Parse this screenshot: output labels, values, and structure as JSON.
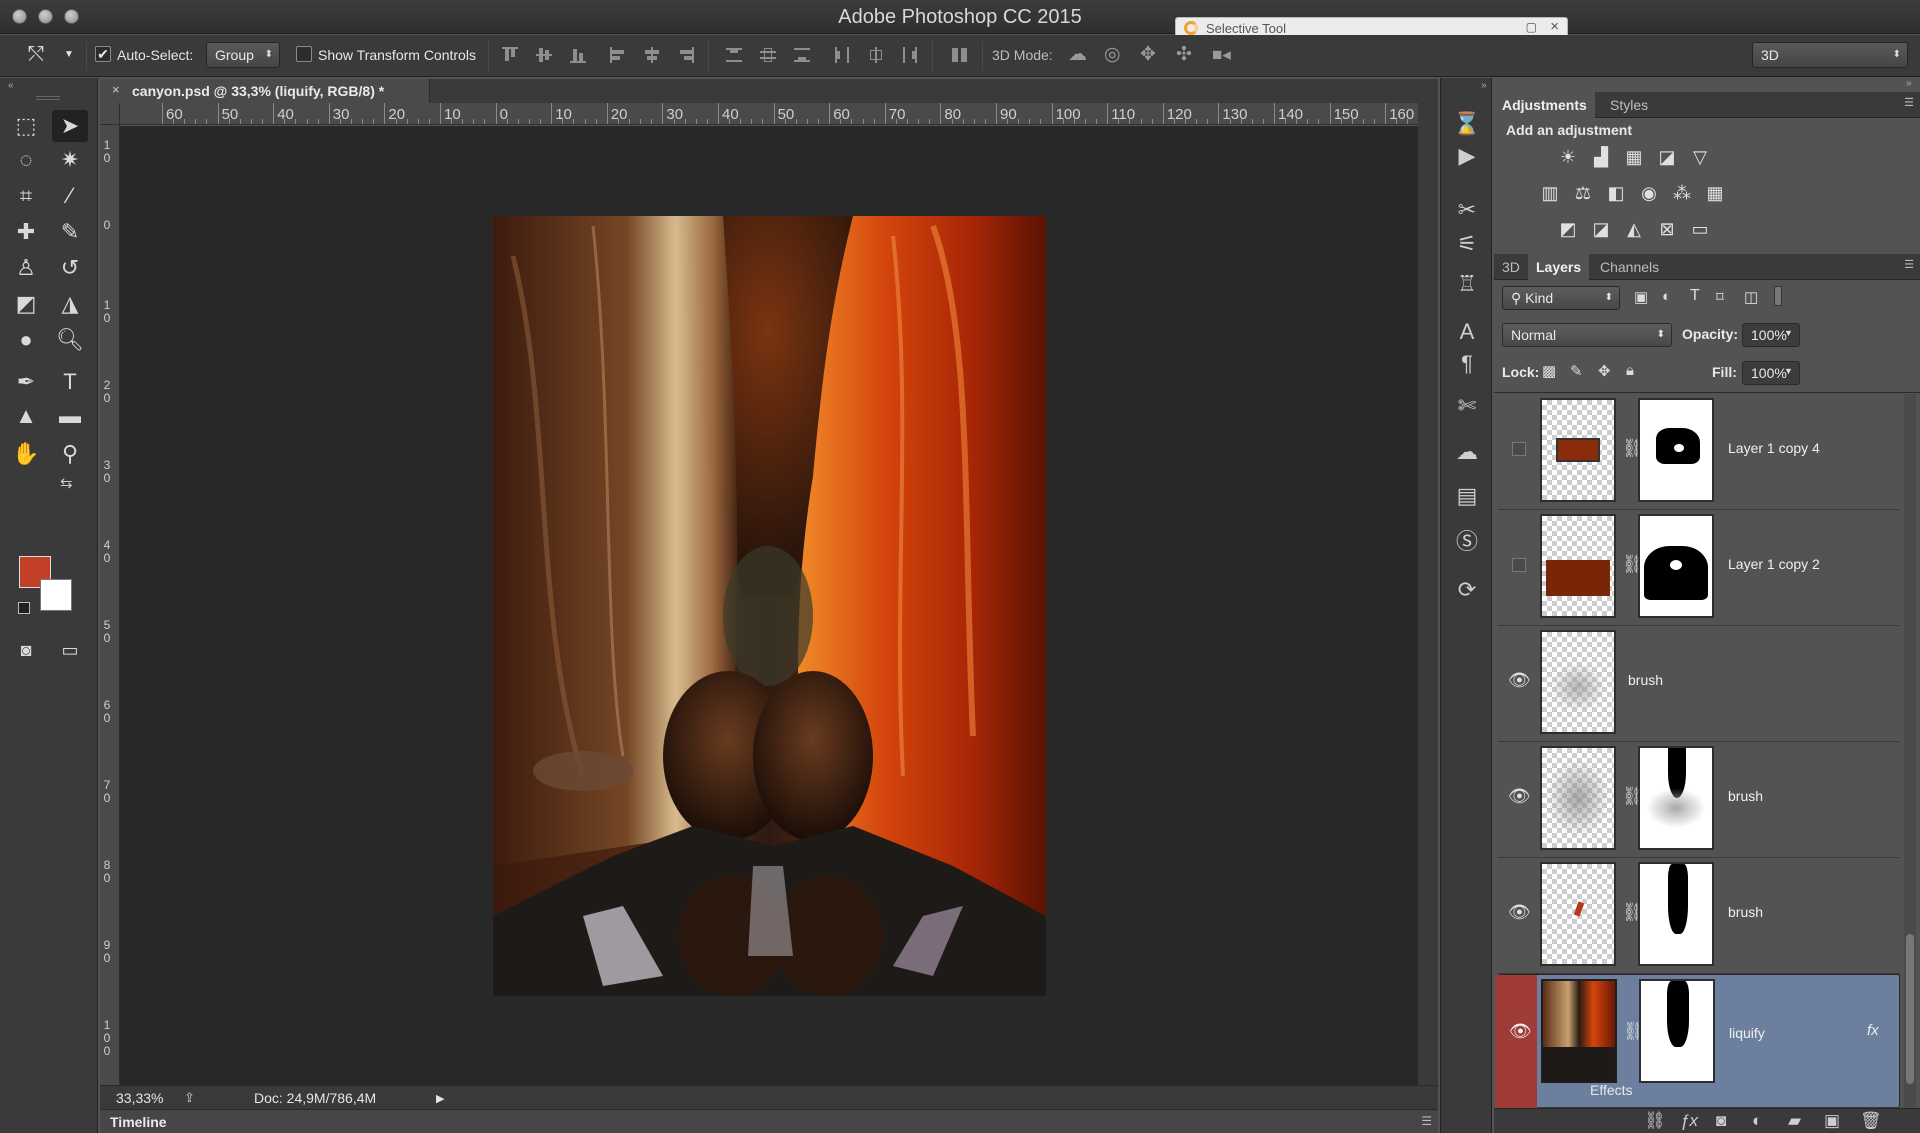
{
  "app": {
    "title": "Adobe Photoshop CC 2015"
  },
  "floating_window": {
    "title": "Selective Tool"
  },
  "options_bar": {
    "auto_select_label": "Auto-Select:",
    "auto_select_checked": true,
    "auto_select_value": "Group",
    "show_transform_label": "Show Transform Controls",
    "show_transform_checked": false,
    "mode_3d_label": "3D Mode:",
    "workspace_value": "3D"
  },
  "document": {
    "tab_title": "canyon.psd @ 33,3% (liquify, RGB/8) *",
    "ruler_h_labels": [
      "60",
      "50",
      "40",
      "30",
      "20",
      "10",
      "0",
      "10",
      "20",
      "30",
      "40",
      "50",
      "60",
      "70",
      "80",
      "90",
      "100",
      "110",
      "120",
      "130",
      "140",
      "150",
      "160"
    ],
    "ruler_v_labels": [
      "1 0",
      "0",
      "1 0",
      "2 0",
      "3 0",
      "4 0",
      "5 0",
      "6 0",
      "7 0",
      "8 0",
      "9 0",
      "1 0 0"
    ],
    "zoom": "33,33%",
    "doc_info": "Doc: 24,9M/786,4M"
  },
  "timeline": {
    "label": "Timeline"
  },
  "colors": {
    "foreground": "#c24025",
    "background": "#ffffff",
    "selected_layer": "#6c7f9e"
  },
  "adjustments": {
    "tabs": [
      "Adjustments",
      "Styles"
    ],
    "heading": "Add an adjustment",
    "icons_row1": [
      "brightness-icon",
      "levels-icon",
      "curves-icon",
      "exposure-icon",
      "vibrance-icon"
    ],
    "icons_row2": [
      "hue-saturation-icon",
      "color-balance-icon",
      "black-white-icon",
      "photo-filter-icon",
      "channel-mixer-icon",
      "color-lookup-icon"
    ],
    "icons_row3": [
      "invert-icon",
      "posterize-icon",
      "threshold-icon",
      "selective-color-icon",
      "gradient-map-icon"
    ]
  },
  "layers_panel": {
    "tabs": [
      "3D",
      "Layers",
      "Channels"
    ],
    "filter_kind": "Kind",
    "blend_mode": "Normal",
    "opacity_label": "Opacity:",
    "opacity_value": "100%",
    "lock_label": "Lock:",
    "fill_label": "Fill:",
    "fill_value": "100%",
    "layers": [
      {
        "name": "Layer 1 copy 4",
        "visible": false,
        "has_mask": true
      },
      {
        "name": "Layer 1 copy 2",
        "visible": false,
        "has_mask": true
      },
      {
        "name": "brush",
        "visible": true,
        "has_mask": false
      },
      {
        "name": "brush",
        "visible": true,
        "has_mask": true
      },
      {
        "name": "brush",
        "visible": true,
        "has_mask": true
      },
      {
        "name": "liquify",
        "visible": true,
        "has_mask": true,
        "selected": true
      }
    ],
    "effects_label": "Effects",
    "fx_label": "fx"
  }
}
